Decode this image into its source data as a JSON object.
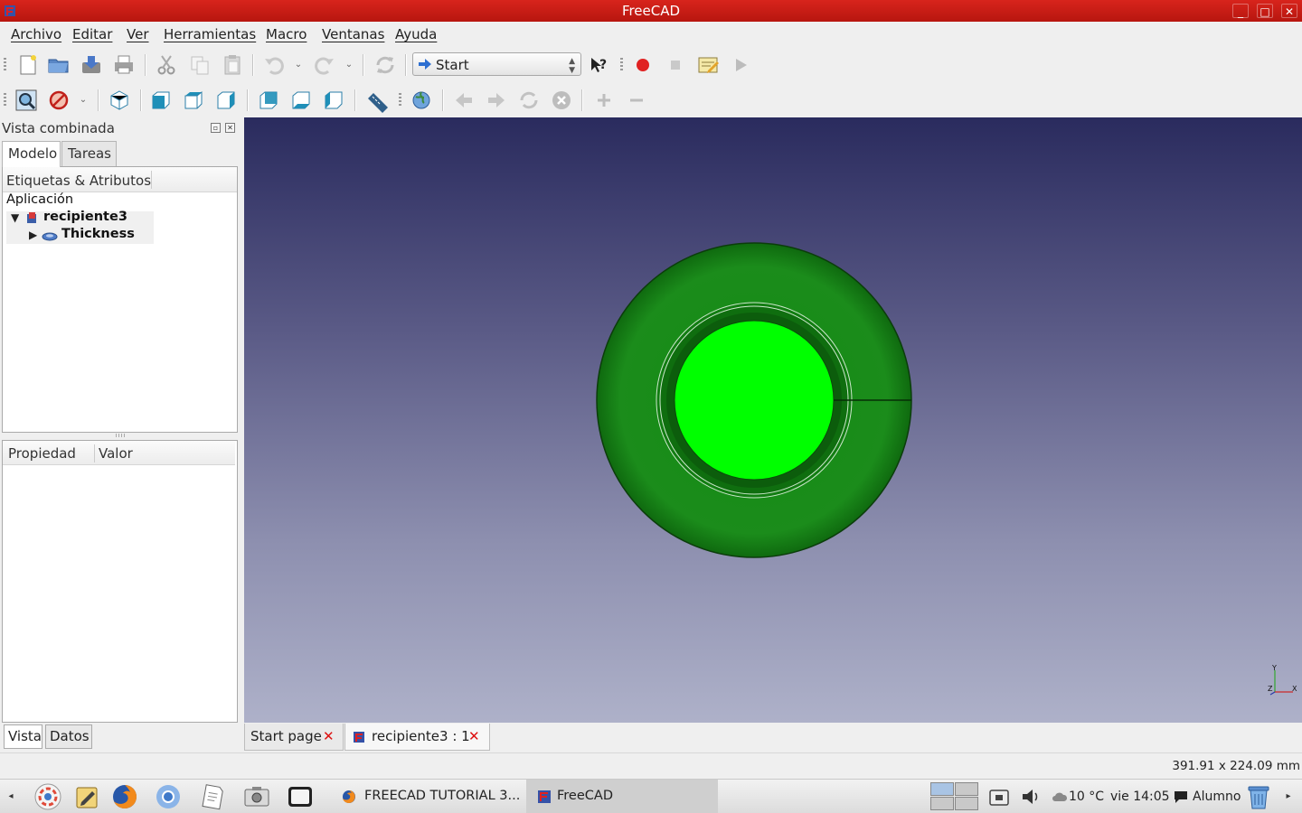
{
  "window": {
    "title": "FreeCAD",
    "controls": [
      "_",
      "□",
      "✕"
    ]
  },
  "menu": [
    "Archivo",
    "Editar",
    "Ver",
    "Herramientas",
    "Macro",
    "Ventanas",
    "Ayuda"
  ],
  "toolbar": {
    "workbench": "Start"
  },
  "combo": {
    "title": "Vista combinada",
    "tabs": [
      "Modelo",
      "Tareas"
    ],
    "tree_header": "Etiquetas & Atributos",
    "tree": {
      "root": "Aplicación",
      "document": "recipiente3",
      "feature": "Thickness"
    },
    "prop_headers": [
      "Propiedad",
      "Valor"
    ],
    "bottom_tabs": [
      "Vista",
      "Datos"
    ]
  },
  "view": {
    "axis_labels": [
      "Y",
      "Z",
      "X"
    ],
    "colors": {
      "outer_ring": "#1f8a1f",
      "inner_face": "#00ff00",
      "bg_top": "#2a2b5e",
      "bg_bottom": "#aeb1c9"
    }
  },
  "doc_tabs": [
    "Start page",
    "recipiente3 : 1"
  ],
  "status": {
    "dimensions": "391.91 x 224.09 mm"
  },
  "taskbar": {
    "tasks": [
      "FREECAD TUTORIAL 3...",
      "FreeCAD"
    ],
    "weather": "10 °C",
    "clock": "vie 14:05",
    "user": "Alumno"
  }
}
